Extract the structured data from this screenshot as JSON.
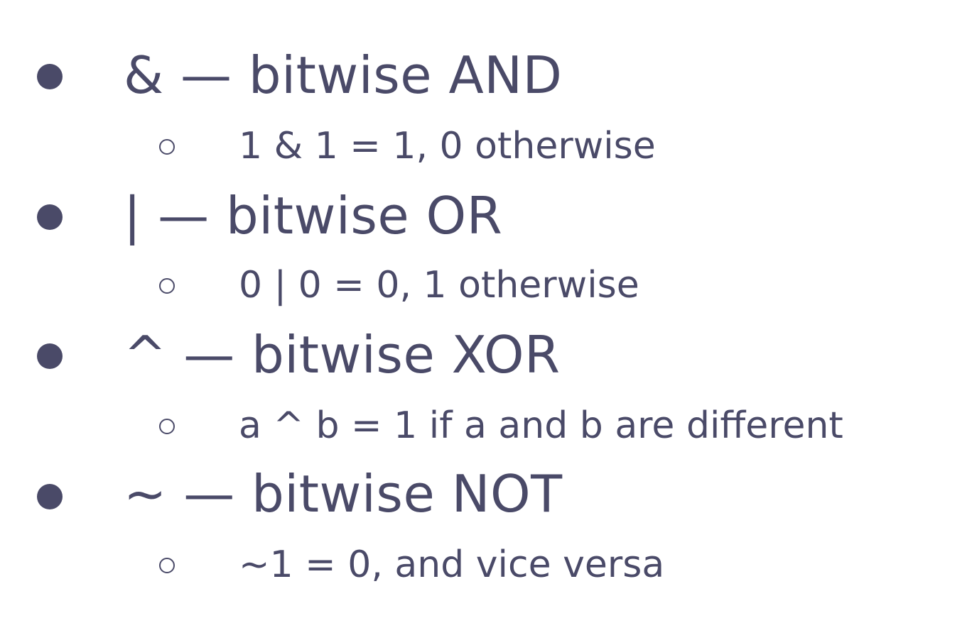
{
  "items": [
    {
      "main": "& — bitwise AND",
      "sub": "1 & 1 = 1, 0 otherwise"
    },
    {
      "main": "| — bitwise OR",
      "sub": "0 | 0 = 0, 1 otherwise"
    },
    {
      "main": "^ — bitwise XOR",
      "sub": "a ^ b = 1 if a and b are different"
    },
    {
      "main": "~ — bitwise NOT",
      "sub": "~1 = 0, and vice versa"
    }
  ],
  "colors": {
    "text": "#4a4a68",
    "background": "#ffffff"
  }
}
